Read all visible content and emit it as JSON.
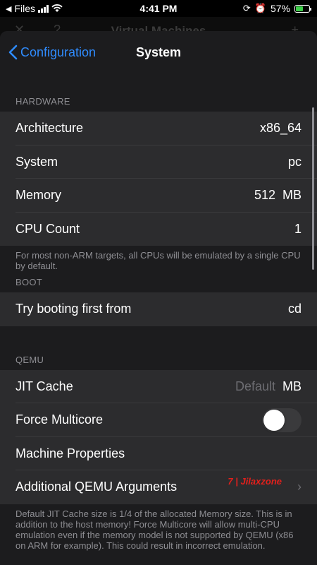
{
  "status_bar": {
    "back_app": "Files",
    "time": "4:41 PM",
    "battery": "57%",
    "battery_level": 0.57
  },
  "background": {
    "title": "Virtual Machines"
  },
  "nav": {
    "back_label": "Configuration",
    "title": "System"
  },
  "sections": {
    "hardware": {
      "header": "HARDWARE",
      "rows": {
        "architecture": {
          "label": "Architecture",
          "value": "x86_64"
        },
        "system": {
          "label": "System",
          "value": "pc"
        },
        "memory": {
          "label": "Memory",
          "value": "512",
          "unit": "MB"
        },
        "cpu_count": {
          "label": "CPU Count",
          "value": "1"
        }
      },
      "footer": "For most non-ARM targets, all CPUs will be emulated by a single CPU by default."
    },
    "boot": {
      "header": "BOOT",
      "rows": {
        "boot_from": {
          "label": "Try booting first from",
          "value": "cd"
        }
      }
    },
    "qemu": {
      "header": "QEMU",
      "rows": {
        "jit_cache": {
          "label": "JIT Cache",
          "placeholder": "Default",
          "unit": "MB"
        },
        "force_multicore": {
          "label": "Force Multicore",
          "enabled": false
        },
        "machine_properties": {
          "label": "Machine Properties"
        },
        "additional_args": {
          "label": "Additional QEMU Arguments"
        }
      },
      "footer": "Default JIT Cache size is 1/4 of the allocated Memory size. This is in addition to the host memory! Force Multicore will allow multi-CPU emulation even if the memory model is not supported by QEMU (x86 on ARM for example). This could result in incorrect emulation."
    }
  },
  "watermark": "7 | Jilaxzone",
  "colors": {
    "accent": "#2f8cff",
    "sheet_bg": "#1c1c1e",
    "row_bg": "#2c2c2e",
    "secondary_text": "#8e8e93",
    "watermark": "#e2201c"
  }
}
